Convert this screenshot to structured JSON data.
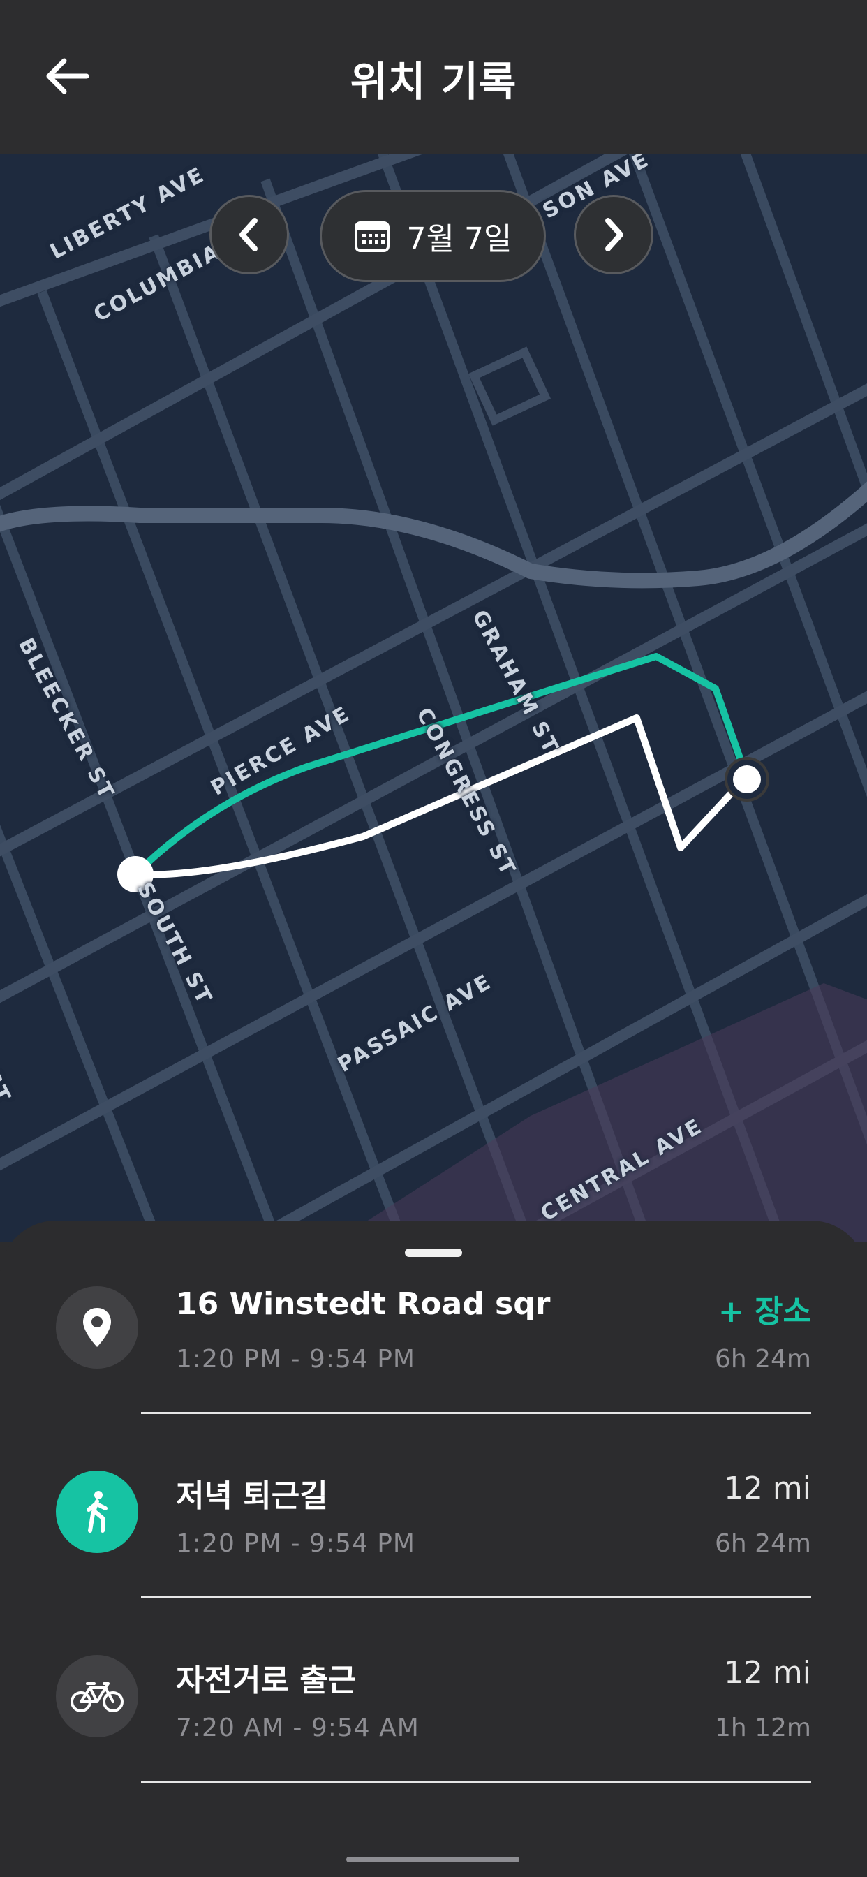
{
  "header": {
    "title": "위치 기록",
    "back_icon": "arrow-left-icon"
  },
  "date_nav": {
    "prev_icon": "chevron-left-icon",
    "next_icon": "chevron-right-icon",
    "calendar_icon": "calendar-icon",
    "date_label": "7월 7일"
  },
  "map": {
    "streets": [
      "LIBERTY AVE",
      "COLUMBIA",
      "SON AVE",
      "BLEECKER ST",
      "GRAHAM ST",
      "CONGRESS ST",
      "PIERCE AVE",
      "SOUTH ST",
      "PASSAIC AVE",
      "CENTRAL AVE",
      "ST"
    ],
    "colors": {
      "background": "#1e2a3e",
      "route_primary": "#16c3a3",
      "route_secondary": "#ffffff"
    }
  },
  "timeline": [
    {
      "icon": "map-pin-icon",
      "name": "16 Winstedt Road sqr",
      "time": "1:20 PM - 9:54 PM",
      "right_top": "+ 장소",
      "right_bottom": "6h 24m"
    },
    {
      "icon": "walking-icon",
      "name": "저녁 퇴근길",
      "time": "1:20 PM - 9:54 PM",
      "right_top": "12 mi",
      "right_bottom": "6h 24m"
    },
    {
      "icon": "bicycle-icon",
      "name": "자전거로 출근",
      "time": "7:20 AM - 9:54 AM",
      "right_top": "12 mi",
      "right_bottom": "1h 12m"
    }
  ],
  "accent_color": "#16c3a3"
}
